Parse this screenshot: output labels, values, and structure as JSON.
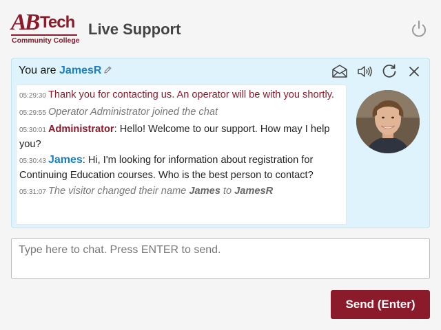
{
  "header": {
    "logo_mark": "AB",
    "logo_tech": "Tech",
    "logo_subtitle": "Community College",
    "title": "Live Support"
  },
  "chat": {
    "you_are_label": "You are",
    "visitor_name": "JamesR",
    "messages": [
      {
        "time": "05:29:30",
        "text": "Thank you for contacting us. An operator will be with you shortly."
      },
      {
        "time": "05:29:55",
        "text": "Operator Administrator joined the chat"
      },
      {
        "time": "05:30:01",
        "author": "Administrator",
        "sep": ":",
        "text": " Hello! Welcome to our support. How may I help you?"
      },
      {
        "time": "05:30:43",
        "author": "James",
        "sep": ":",
        "text": " Hi, I'm looking for information about registration for Continuing Education courses. Who is the best person to contact?"
      },
      {
        "time": "05:31:07",
        "text_prefix": "The visitor changed their name",
        "old_name": "James",
        "to_word": "to",
        "new_name": "JamesR"
      }
    ]
  },
  "input": {
    "placeholder": "Type here to chat. Press ENTER to send."
  },
  "send": {
    "label": "Send (Enter)"
  },
  "icons": {
    "power": "power-icon",
    "email": "envelope-icon",
    "sound": "speaker-icon",
    "refresh": "refresh-icon",
    "close": "close-icon",
    "edit": "pencil-icon"
  },
  "colors": {
    "brand": "#8b1a2b",
    "visitor": "#1b7ec2",
    "panel": "#def3fb"
  }
}
